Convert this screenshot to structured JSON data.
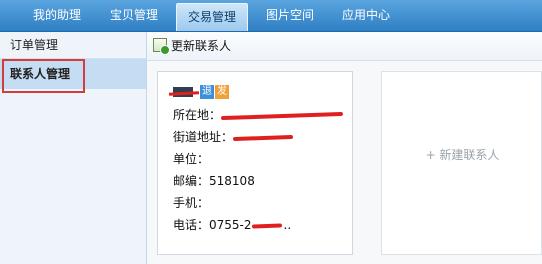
{
  "nav": {
    "tabs": [
      {
        "label": "我的助理"
      },
      {
        "label": "宝贝管理"
      },
      {
        "label": "交易管理"
      },
      {
        "label": "图片空间"
      },
      {
        "label": "应用中心"
      }
    ],
    "active_tab": "交易管理"
  },
  "sidebar": {
    "items": [
      {
        "label": "订单管理"
      },
      {
        "label": "联系人管理"
      }
    ],
    "selected": "联系人管理"
  },
  "toolbar": {
    "refresh_label": "更新联系人",
    "refresh_icon": "refresh-contacts-icon"
  },
  "contact_card": {
    "badge_1": "退",
    "badge_2": "发",
    "location_label": "所在地：",
    "street_label": "街道地址：",
    "company_label": "单位：",
    "zip_label": "邮编：",
    "zip_value": "518108",
    "mobile_label": "手机：",
    "phone_label": "电话：",
    "phone_value_prefix": "0755-2",
    "phone_value_suffix": ".."
  },
  "new_contact": {
    "label": "+ 新建联系人"
  },
  "colors": {
    "nav_top": "#5aa5df",
    "nav_bottom": "#2f7fc4",
    "sidebar_bg": "#eef4fa",
    "sidebar_selected": "#c4ddf2",
    "annotation_red": "#d43b3b",
    "redaction_red": "#e02020"
  }
}
